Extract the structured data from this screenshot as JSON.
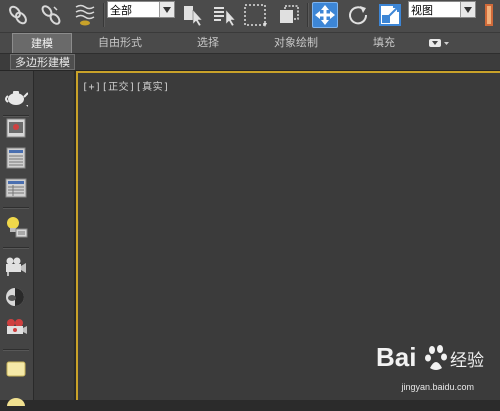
{
  "toolbar": {
    "selection_filter": "全部",
    "reference_coord": "视图"
  },
  "ribbon": {
    "tabs": [
      {
        "label": "建模",
        "active": true
      },
      {
        "label": "自由形式",
        "active": false
      },
      {
        "label": "选择",
        "active": false
      },
      {
        "label": "对象绘制",
        "active": false
      },
      {
        "label": "填充",
        "active": false
      }
    ]
  },
  "subbar": {
    "label": "多边形建模"
  },
  "viewport": {
    "menu_plus": "[+]",
    "menu_view": "[正交]",
    "menu_shading": "[真实]"
  },
  "watermark": {
    "brand": "Bai",
    "brand_cn": "经验",
    "url": "jingyan.baidu.com"
  },
  "colors": {
    "accent": "#3d86d6",
    "viewport_border": "#c9a229"
  }
}
